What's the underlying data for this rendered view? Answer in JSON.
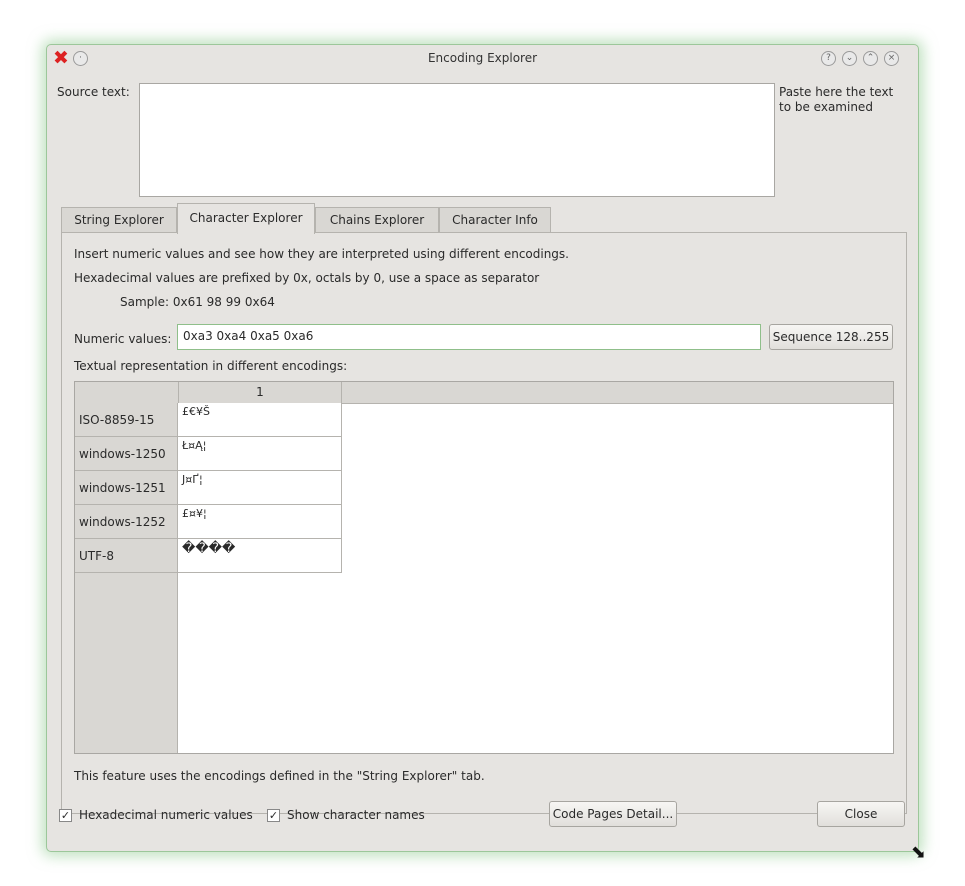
{
  "window": {
    "title": "Encoding Explorer"
  },
  "source": {
    "label": "Source text:",
    "hint": "Paste here the text to be examined",
    "value": ""
  },
  "tabs": [
    {
      "label": "String Explorer"
    },
    {
      "label": "Character Explorer"
    },
    {
      "label": "Chains Explorer"
    },
    {
      "label": "Character Info"
    }
  ],
  "panel": {
    "line1": "Insert numeric values and see how they are interpreted using different encodings.",
    "line2": "Hexadecimal values are prefixed by 0x, octals by 0, use a space as separator",
    "sample": "Sample: 0x61 98 99 0x64",
    "numeric_label": "Numeric values:",
    "numeric_value": "0xa3 0xa4 0xa5 0xa6",
    "sequence_button": "Sequence 128..255",
    "table_label": "Textual representation in different encodings:",
    "table": {
      "column_header": "1",
      "rows": [
        {
          "encoding": "ISO-8859-15",
          "value": "£€¥Š"
        },
        {
          "encoding": "windows-1250",
          "value": "Ł¤Ą¦"
        },
        {
          "encoding": "windows-1251",
          "value": "Ј¤Ґ¦"
        },
        {
          "encoding": "windows-1252",
          "value": "£¤¥¦"
        },
        {
          "encoding": "UTF-8",
          "value": "����"
        }
      ]
    },
    "footer_note": "This feature uses the encodings defined in the \"String Explorer\" tab."
  },
  "bottom": {
    "hex_checkbox": {
      "label": "Hexadecimal numeric values",
      "checked": true
    },
    "names_checkbox": {
      "label": "Show character names",
      "checked": true
    },
    "code_pages_button": "Code Pages Detail...",
    "close_button": "Close"
  }
}
